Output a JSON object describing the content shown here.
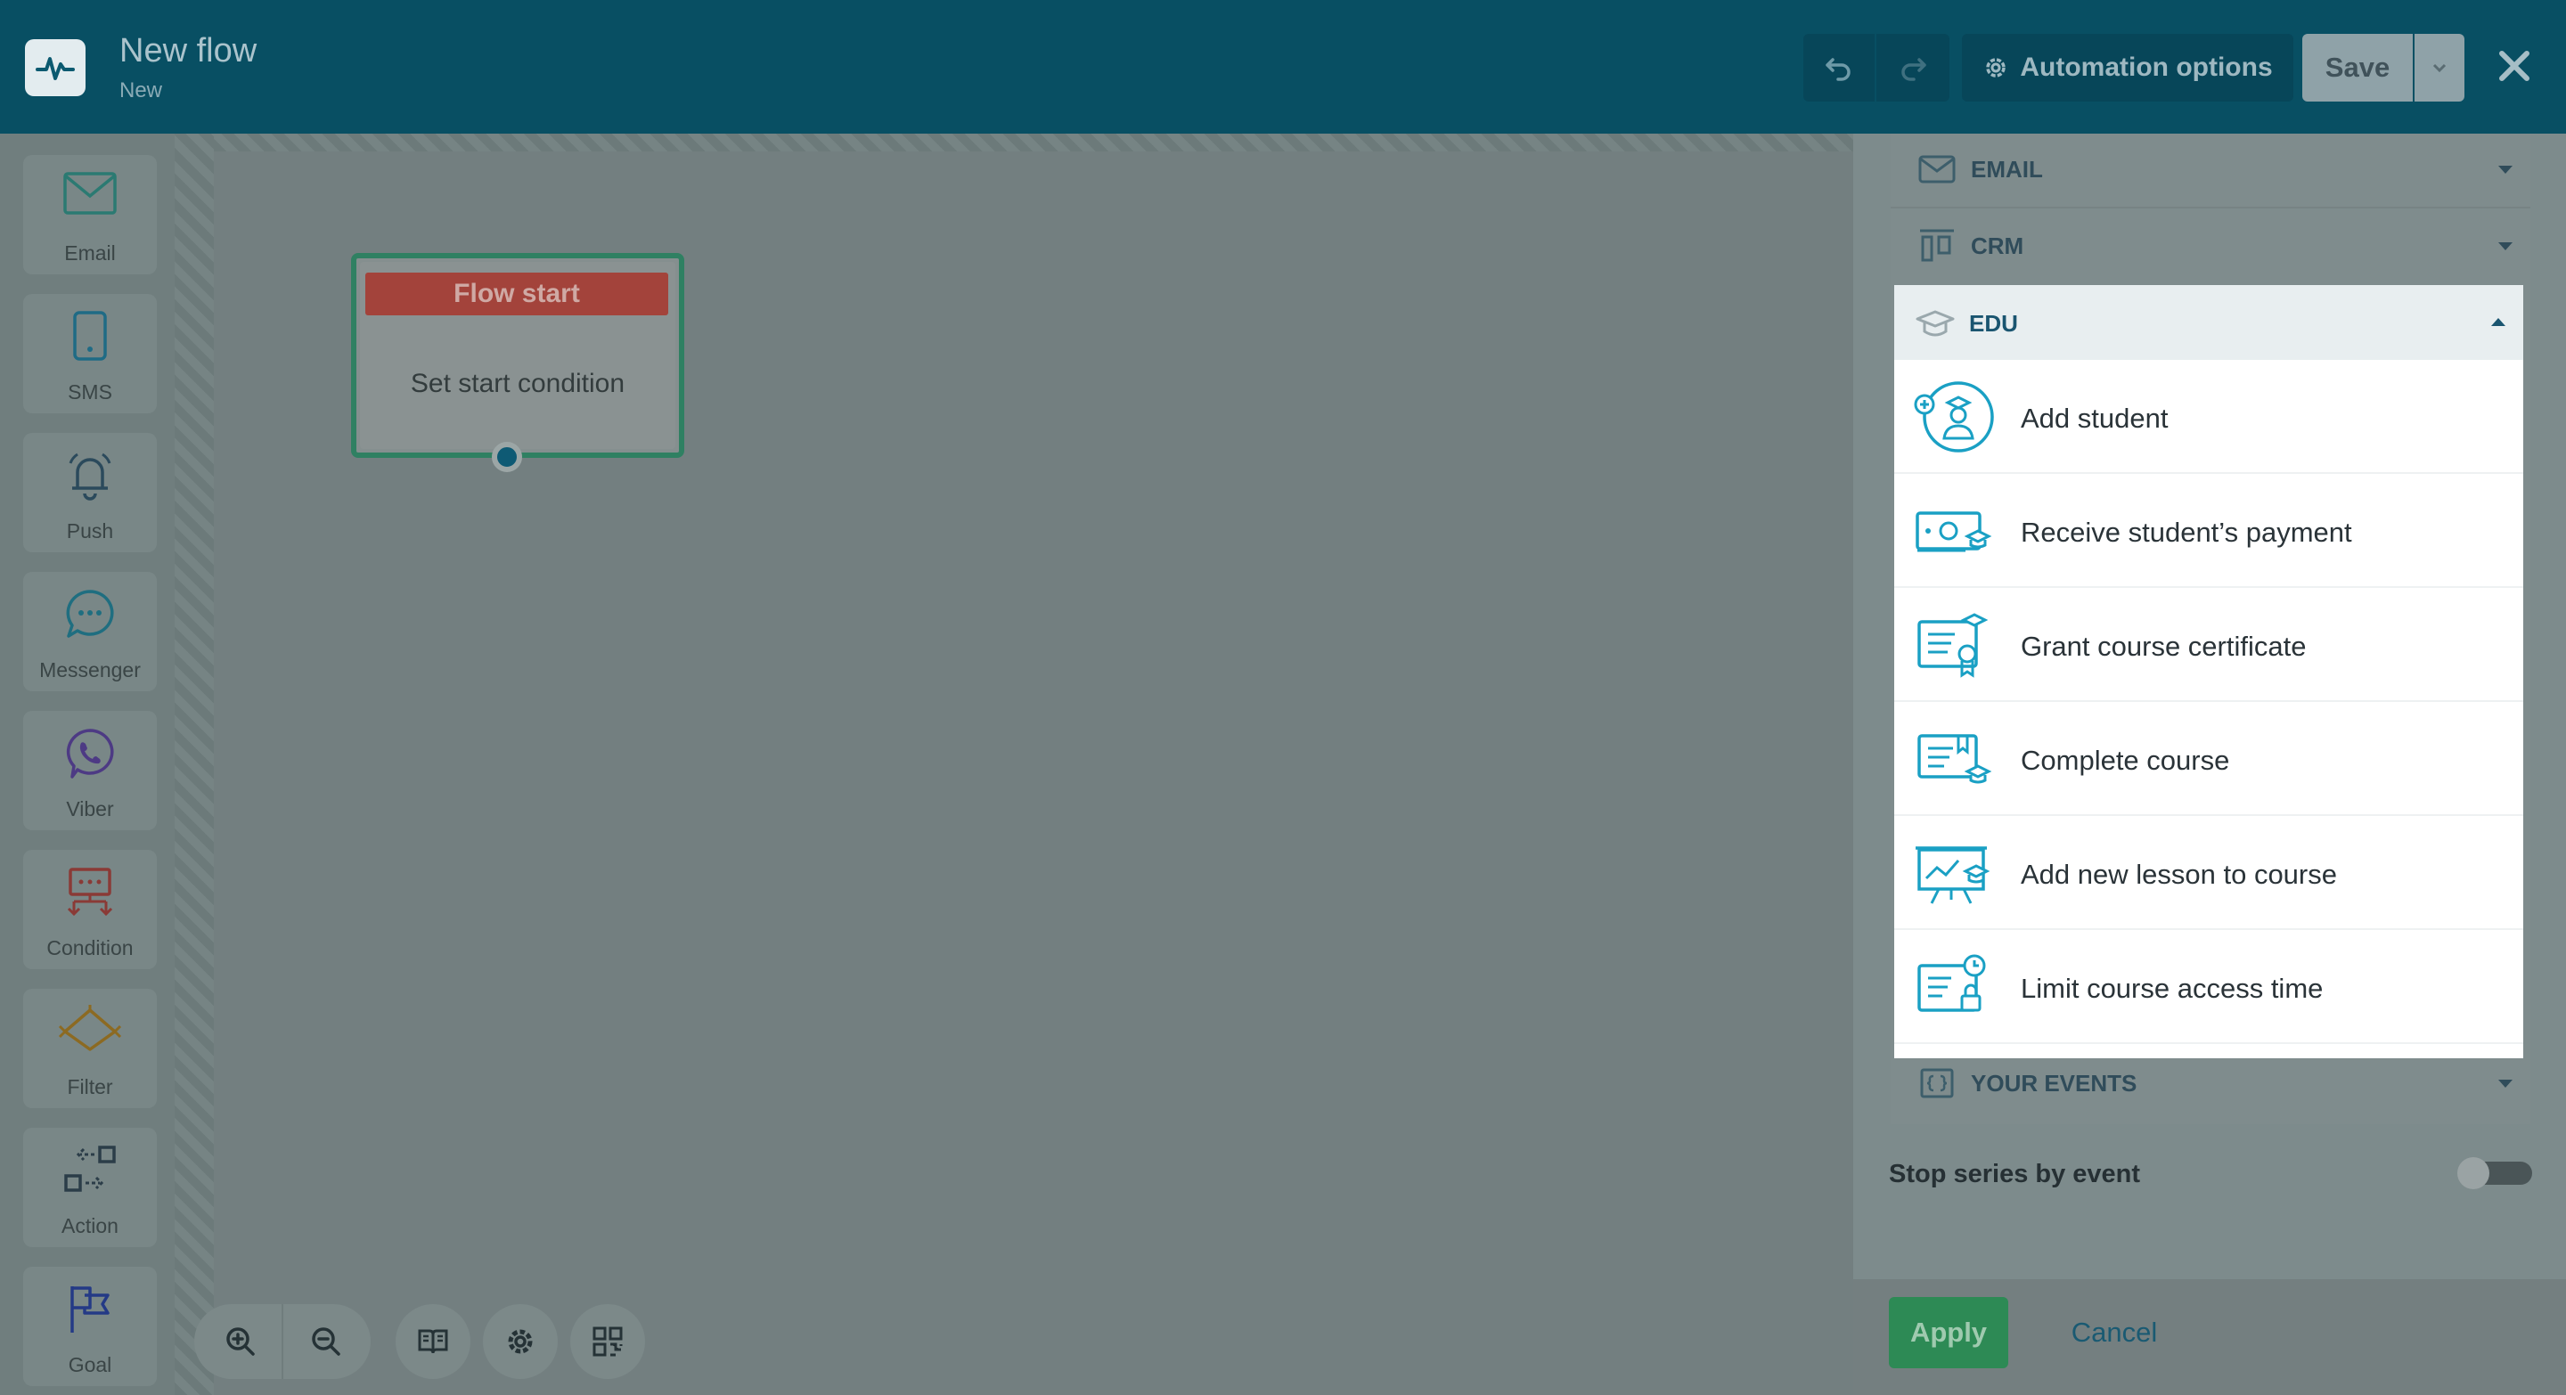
{
  "header": {
    "title": "New flow",
    "subtitle": "New",
    "automation_options": "Automation options",
    "save": "Save"
  },
  "toolbar": {
    "items": [
      {
        "label": "Email",
        "icon": "envelope-icon"
      },
      {
        "label": "SMS",
        "icon": "phone-icon"
      },
      {
        "label": "Push",
        "icon": "bell-icon"
      },
      {
        "label": "Messenger",
        "icon": "chat-bubble-icon"
      },
      {
        "label": "Viber",
        "icon": "viber-icon"
      },
      {
        "label": "Condition",
        "icon": "condition-icon"
      },
      {
        "label": "Filter",
        "icon": "filter-icon"
      },
      {
        "label": "Action",
        "icon": "action-icon"
      },
      {
        "label": "Goal",
        "icon": "flag-icon"
      }
    ]
  },
  "canvas": {
    "node": {
      "title": "Flow start",
      "body": "Set start condition"
    }
  },
  "panel": {
    "sections": {
      "email": "EMAIL",
      "crm": "CRM",
      "edu": "EDU",
      "your_events": "YOUR EVENTS"
    },
    "edu_items": [
      {
        "label": "Add student",
        "icon": "add-student-icon"
      },
      {
        "label": "Receive student’s payment",
        "icon": "student-payment-icon"
      },
      {
        "label": "Grant course certificate",
        "icon": "certificate-icon"
      },
      {
        "label": "Complete course",
        "icon": "complete-course-icon"
      },
      {
        "label": "Add new lesson to course",
        "icon": "lesson-board-icon"
      },
      {
        "label": "Limit course access time",
        "icon": "access-time-lock-icon"
      }
    ],
    "stop_series": "Stop series by event",
    "stop_series_enabled": false,
    "apply": "Apply",
    "cancel": "Cancel"
  },
  "colors": {
    "header_bg": "#084f63",
    "node_head": "#a3433b",
    "node_border": "#2f8062",
    "accent_teal": "#1aa0c4",
    "apply_green": "#2d8a55"
  }
}
